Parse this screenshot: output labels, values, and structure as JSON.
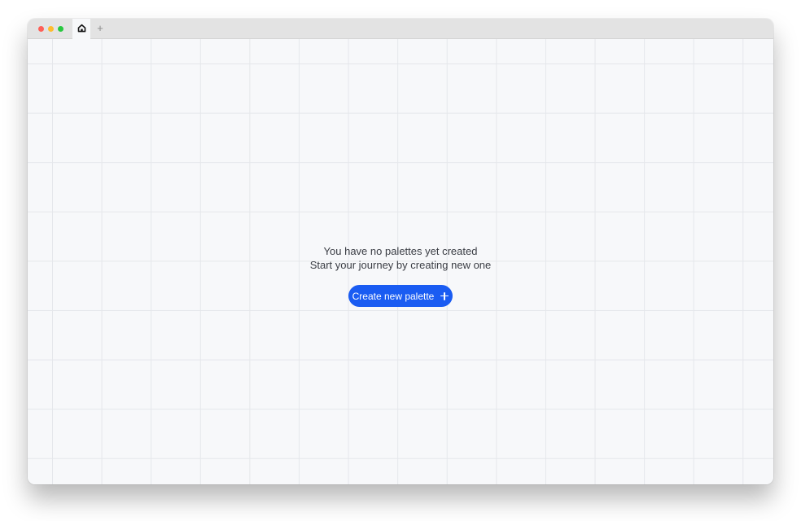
{
  "window": {
    "tabs": [
      {
        "icon": "home-icon",
        "active": true
      }
    ],
    "add_tab_label": "+"
  },
  "empty_state": {
    "line1": "You have no palettes yet created",
    "line2": "Start your journey by creating new one",
    "button_label": "Create new palette",
    "button_icon": "plus-icon"
  },
  "colors": {
    "accent": "#1a5cf2",
    "canvas_bg": "#f7f8fa",
    "grid_line": "#e5e7eb",
    "titlebar": "#e3e3e3",
    "traffic_close": "#fe5f57",
    "traffic_minimize": "#febc2e",
    "traffic_zoom": "#28c840"
  }
}
